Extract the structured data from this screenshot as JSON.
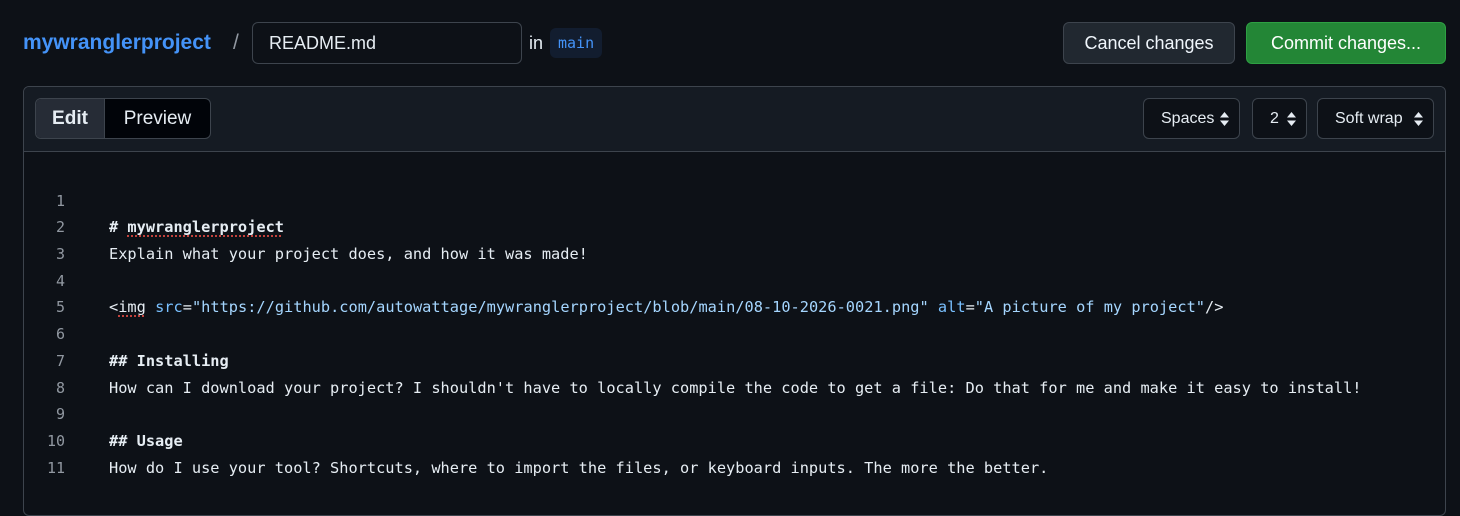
{
  "header": {
    "repo_name": "mywranglerproject",
    "separator": "/",
    "filename": "README.md",
    "in_label": "in",
    "branch": "main",
    "cancel_label": "Cancel changes",
    "commit_label": "Commit changes..."
  },
  "editor": {
    "tabs": [
      {
        "label": "Edit",
        "active": true
      },
      {
        "label": "Preview",
        "active": false
      }
    ],
    "indent_mode": "Spaces",
    "indent_size": "2",
    "wrap_mode": "Soft wrap",
    "line_numbers": [
      "1",
      "2",
      "3",
      "4",
      "5",
      "6",
      "7",
      "8",
      "9",
      "10",
      "11"
    ],
    "lines": {
      "l1_hash": "# ",
      "l1_title": "mywranglerproject",
      "l2": "Explain what your project does, and how it was made!",
      "l4_open": "<",
      "l4_tag": "img",
      "l4_src_attr": "src",
      "l4_eq1": "=",
      "l4_src_val": "\"https://github.com/autowattage/mywranglerproject/blob/main/08-10-2026-0021.png\"",
      "l4_alt_attr": "alt",
      "l4_eq2": "=",
      "l4_alt_val": "\"A picture of my project\"",
      "l4_close": "/>",
      "l6": "## Installing",
      "l7": "How can I download your project? I shouldn't have to locally compile the code to get a file: Do that for me and make it easy to install!",
      "l9": "## Usage",
      "l10": "How do I use your tool? Shortcuts, where to import the files, or keyboard inputs. The more the better."
    }
  },
  "colors": {
    "background": "#0d1117",
    "link": "#4493f8",
    "commit_button": "#238636",
    "attribute": "#79c0ff",
    "string": "#a5d6ff"
  },
  "icons": {
    "select_caret": "up-down-caret-icon"
  }
}
